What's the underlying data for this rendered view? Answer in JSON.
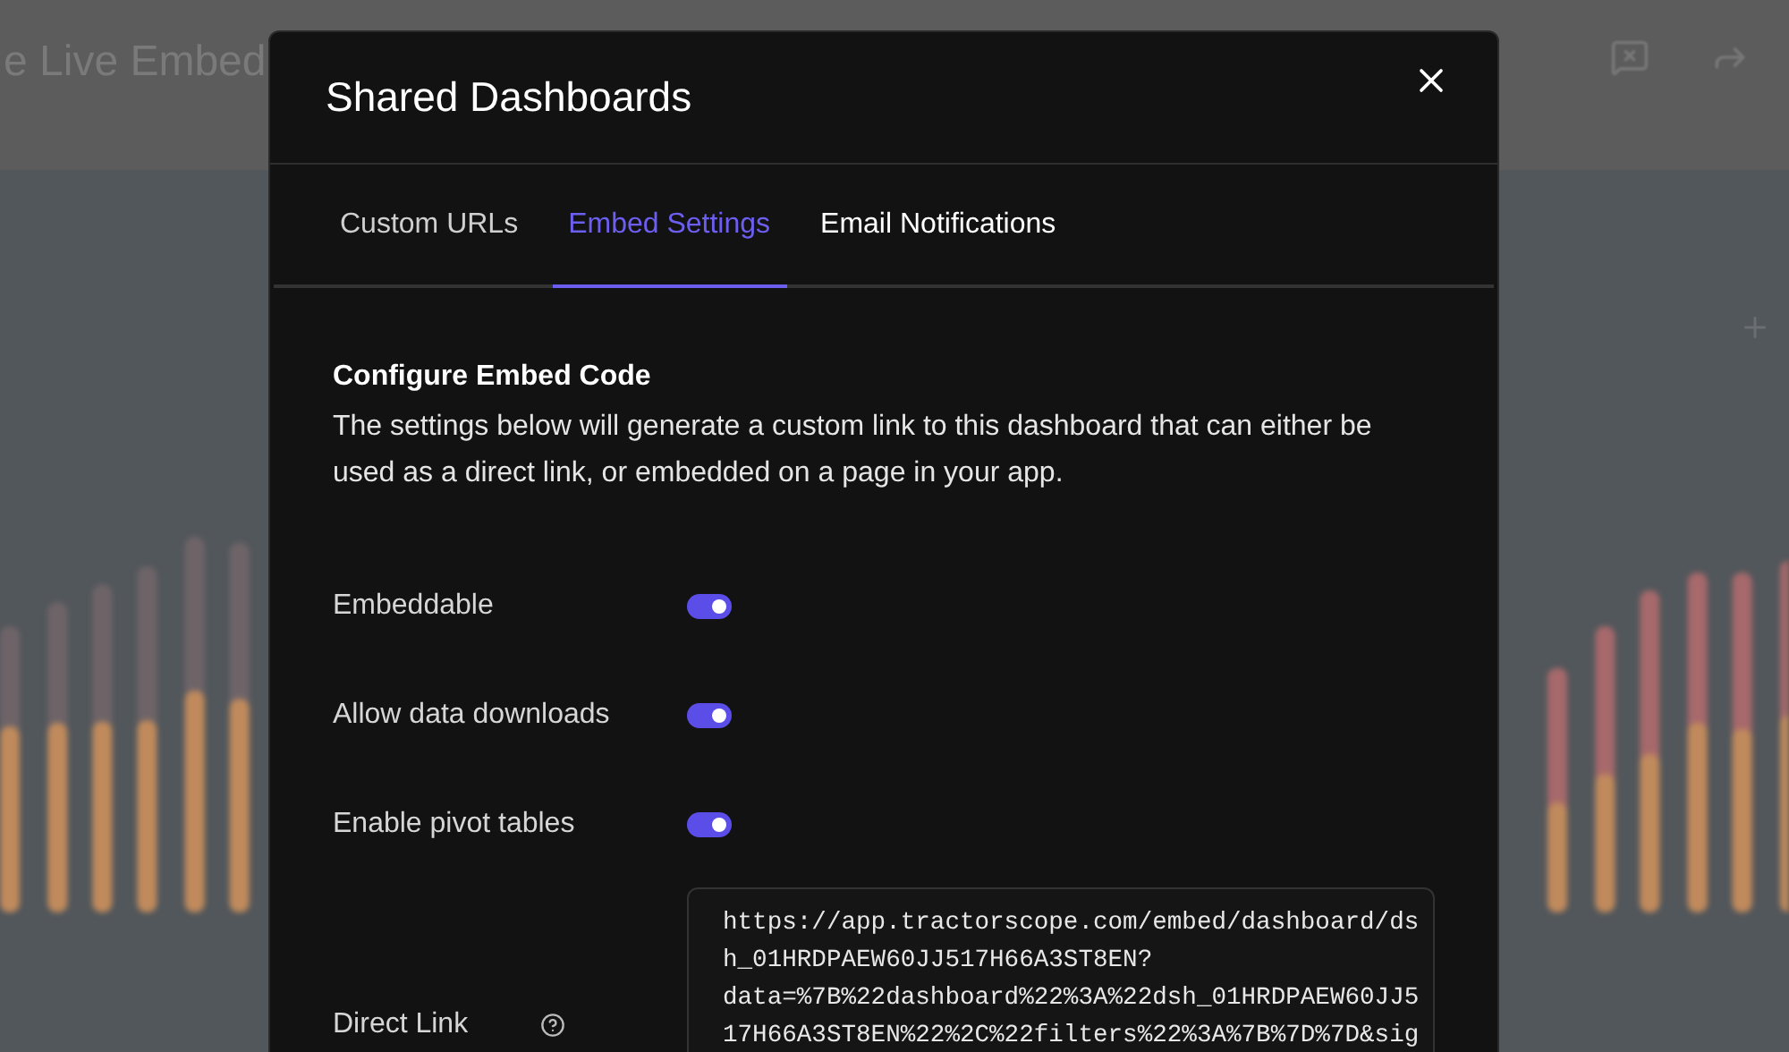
{
  "background": {
    "title": "e Live Embed"
  },
  "modal": {
    "title": "Shared Dashboards",
    "tabs": [
      {
        "label": "Custom URLs",
        "selected": false
      },
      {
        "label": "Embed Settings",
        "selected": true
      },
      {
        "label": "Email Notifications",
        "selected": false
      }
    ],
    "section_title": "Configure Embed Code",
    "description": "The settings below will generate a custom link to this dashboard that can either be used as a direct link, or embedded on a page in your app.",
    "toggles": [
      {
        "label": "Embeddable",
        "on": true
      },
      {
        "label": "Allow data downloads",
        "on": true
      },
      {
        "label": "Enable pivot tables",
        "on": true
      }
    ],
    "direct_link": {
      "label": "Direct Link",
      "value": "https://app.tractorscope.com/embed/dashboard/dsh_01HRDPAEW60JJ517H66A3ST8EN?data=%7B%22dashboard%22%3A%22dsh_01HRDPAEW60JJ517H66A3ST8EN%22%2C%22filters%22%3A%7B%7D%7D&sig"
    }
  }
}
